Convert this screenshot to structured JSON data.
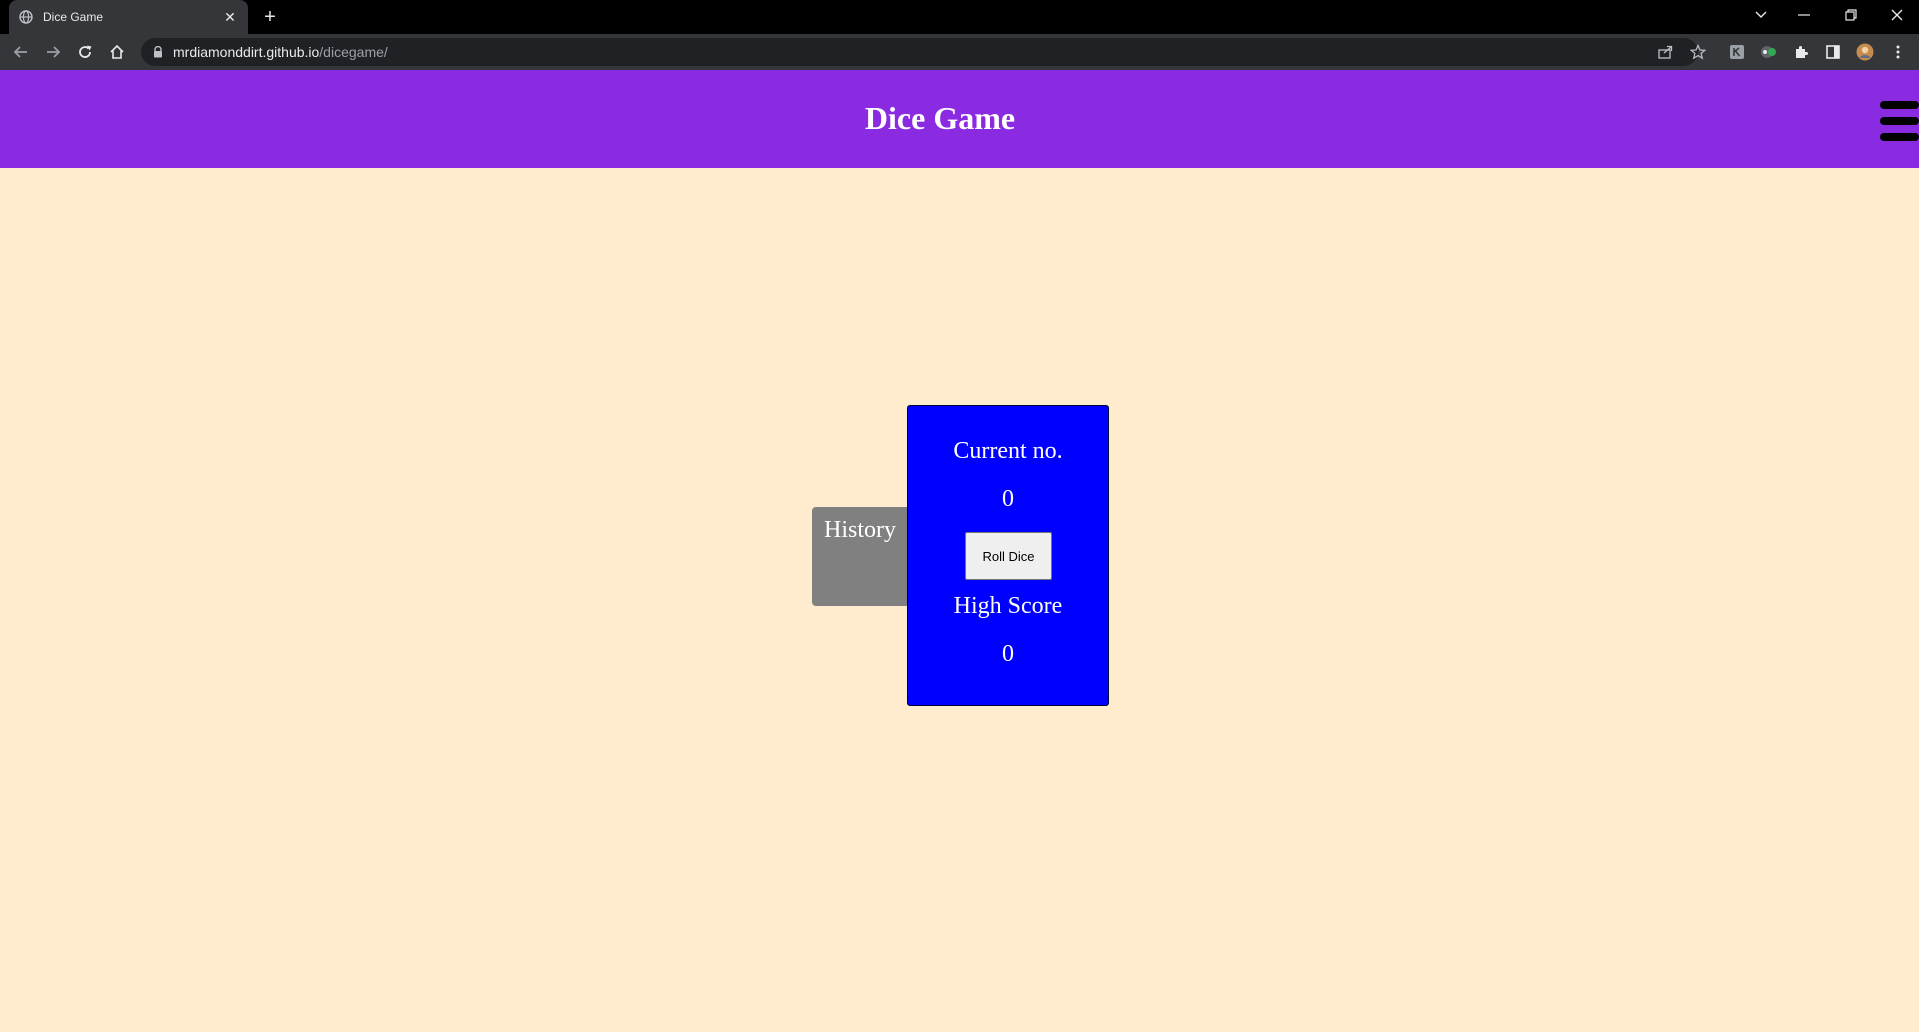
{
  "browser": {
    "tab_title": "Dice Game",
    "url_host": "mrdiamonddirt.github.io",
    "url_path": "/dicegame/"
  },
  "header": {
    "title": "Dice Game",
    "background": "#8a2be2"
  },
  "history": {
    "label": "History"
  },
  "game": {
    "current_label": "Current no.",
    "current_value": "0",
    "roll_button_label": "Roll Dice",
    "high_score_label": "High Score",
    "high_score_value": "0",
    "card_color": "#0000ff"
  },
  "icons": {
    "menu": "hamburger-icon",
    "back": "back-arrow-icon",
    "forward": "forward-arrow-icon",
    "reload": "reload-icon",
    "home": "home-icon",
    "lock": "lock-icon",
    "share": "share-icon",
    "bookmark": "star-icon"
  }
}
